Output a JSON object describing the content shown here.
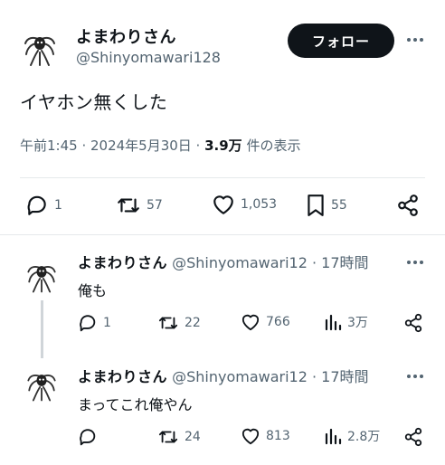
{
  "main_tweet": {
    "display_name": "よまわりさん",
    "handle": "@Shinyomawari128",
    "follow_label": "フォロー",
    "text": "イヤホン無くした",
    "timestamp": "午前1:45 · 2024年5月30日 · ",
    "views_count": "3.9万",
    "views_label": " 件の表示",
    "stats": {
      "replies": "1",
      "retweets": "57",
      "likes": "1,053",
      "bookmarks": "55"
    }
  },
  "replies": [
    {
      "display_name": "よまわりさん",
      "handle_time": " @Shinyomawari12 · 17時間",
      "text": "俺も",
      "stats": {
        "replies": "1",
        "retweets": "22",
        "likes": "766",
        "views": "3万"
      }
    },
    {
      "display_name": "よまわりさん",
      "handle_time": " @Shinyomawari12 · 17時間",
      "text": "まってこれ俺やん",
      "stats": {
        "replies": "",
        "retweets": "24",
        "likes": "813",
        "views": "2.8万"
      }
    }
  ],
  "icons": {
    "reply": "speech-bubble-icon",
    "retweet": "retweet-icon",
    "like": "heart-icon",
    "bookmark": "bookmark-icon",
    "share": "share-icon",
    "views": "bar-chart-icon",
    "more": "more-dots-icon"
  },
  "colors": {
    "text_primary": "#0f1419",
    "text_secondary": "#536471",
    "follow_button_bg": "#0f1419",
    "divider": "#e6e9eb"
  }
}
